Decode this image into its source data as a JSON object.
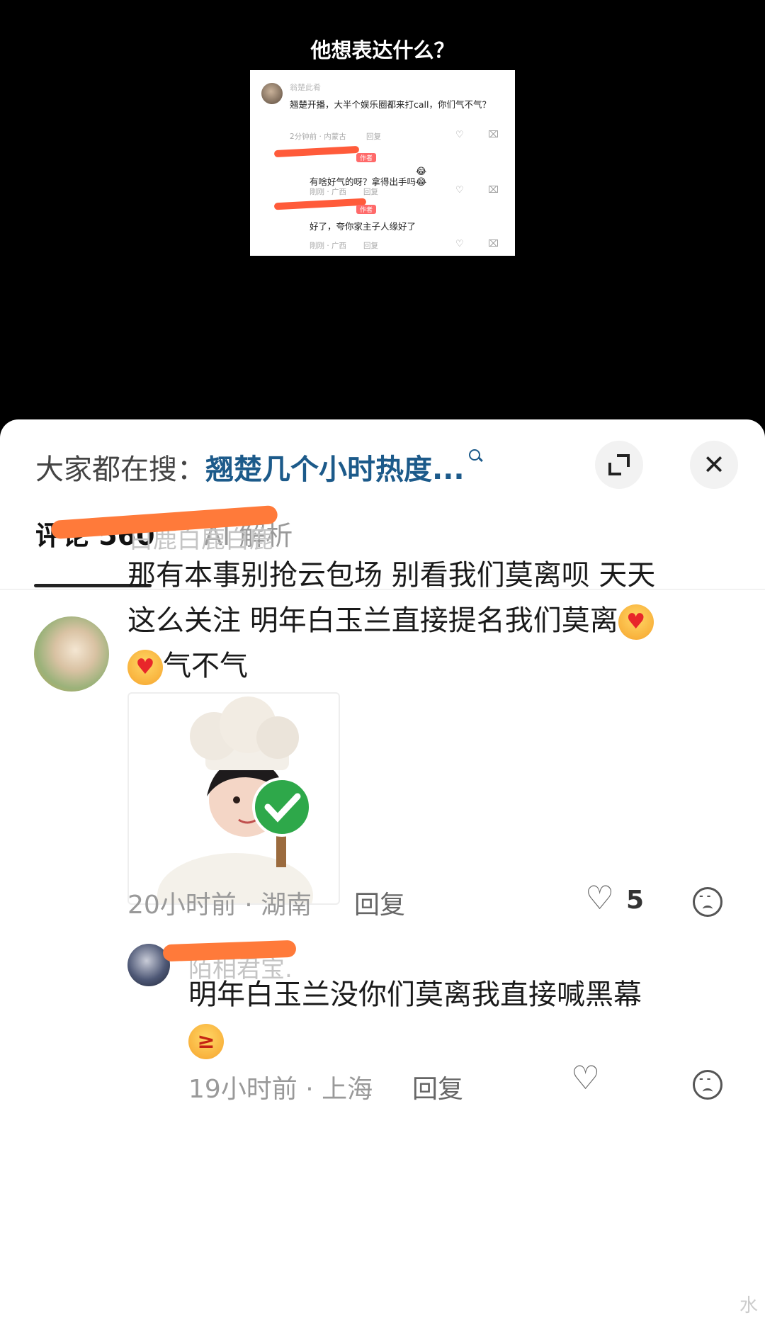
{
  "video": {
    "caption": "他想表达什么？",
    "screenshot": {
      "comment_name": "翁楚此肴",
      "comment_text": "翘楚开播，大半个娱乐圈都来打call，你们气不气？",
      "comment_meta": "2分钟前 · 内蒙古",
      "comment_reply": "回复",
      "reply1_tag": "作者",
      "reply1_text": "有啥好气的呀？拿得出手吗",
      "reply1_meta": "刚刚 · 广西",
      "reply1_reply": "回复",
      "reply2_tag": "作者",
      "reply2_text": "好了，夸你家主子人缘好了",
      "reply2_meta": "刚刚 · 广西",
      "reply2_reply": "回复"
    }
  },
  "sheet": {
    "search_prefix": "大家都在搜：",
    "search_keyword": "翘楚几个小时热度...",
    "close_glyph": "✕",
    "tabs": [
      {
        "label": "评论 560"
      },
      {
        "label": "AI 解析"
      }
    ]
  },
  "comments": [
    {
      "username": "白鹿白鹿白鹿",
      "lines": [
        "那有本事别抢云包场 别看我们莫离呗 天天",
        "这么关注 明年白玉兰直接提名我们莫离",
        "气不气"
      ],
      "time_location": "20小时前 · 湖南",
      "reply_label": "回复",
      "likes": "5"
    },
    {
      "username": "陌相君宝.",
      "lines": [
        "明年白玉兰没你们莫离我直接喊黑幕"
      ],
      "time_location": "19小时前 · 上海",
      "reply_label": "回复"
    }
  ],
  "watermark": "水",
  "colors": {
    "keyword": "#1c5a8a",
    "scribble": "#ff7a3a",
    "background_top": "#000000"
  }
}
